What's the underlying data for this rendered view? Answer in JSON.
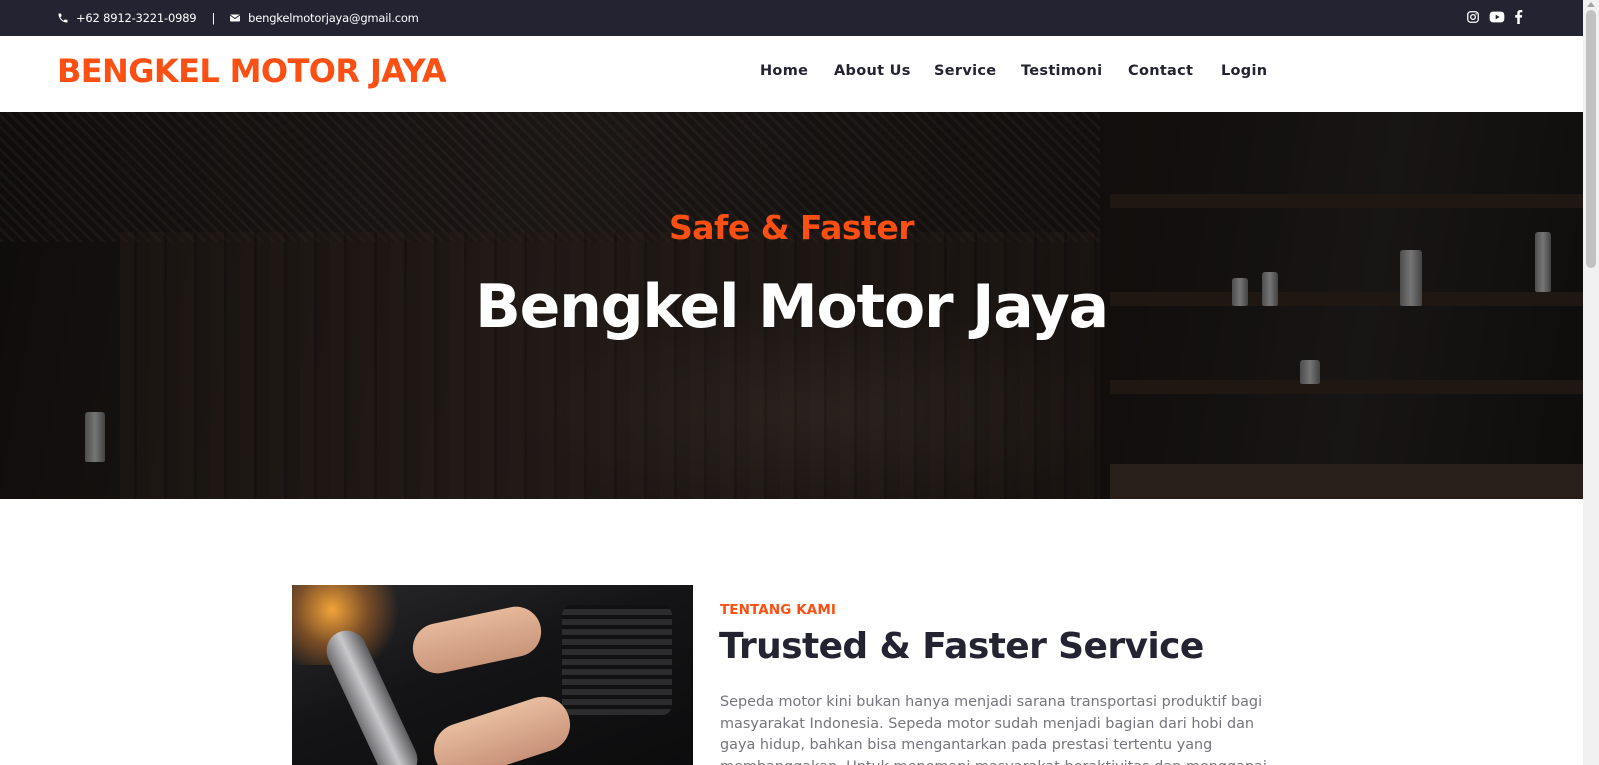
{
  "topbar": {
    "phone": "+62 8912-3221-0989",
    "separator": "|",
    "email": "bengkelmotorjaya@gmail.com",
    "icons": [
      "phone-icon",
      "envelope-icon",
      "instagram-icon",
      "youtube-icon",
      "facebook-icon"
    ]
  },
  "navbar": {
    "brand": "BENGKEL MOTOR JAYA",
    "links": [
      "Home",
      "About Us",
      "Service",
      "Testimoni",
      "Contact",
      "Login"
    ]
  },
  "hero": {
    "subtitle": "Safe & Faster",
    "title": "Bengkel Motor Jaya"
  },
  "about": {
    "kicker": "TENTANG KAMI",
    "title": "Trusted & Faster Service",
    "text": "Sepeda motor kini bukan hanya menjadi sarana transportasi produktif bagi masyarakat Indonesia. Sepeda motor sudah menjadi bagian dari hobi dan gaya hidup, bahkan bisa mengantarkan pada prestasi tertentu yang membanggakan. Untuk menemani masyarakat beraktivitas dan menggapai"
  },
  "colors": {
    "accent": "#fc4f13",
    "dark": "#232331",
    "muted_text": "#75757d"
  }
}
